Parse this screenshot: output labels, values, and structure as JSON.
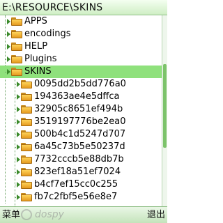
{
  "title": "E:\\RESOURCE\\SKINS",
  "tree": [
    {
      "label": "APPS",
      "expandable": true,
      "level": 0,
      "selected": false
    },
    {
      "label": "encodings",
      "expandable": true,
      "level": 0,
      "selected": false
    },
    {
      "label": "HELP",
      "expandable": true,
      "level": 0,
      "selected": false
    },
    {
      "label": "Plugins",
      "expandable": true,
      "level": 0,
      "selected": false
    },
    {
      "label": "SKINS",
      "expandable": true,
      "level": 0,
      "selected": true
    },
    {
      "label": "0095dd2b5dd776a0",
      "expandable": true,
      "level": 1,
      "selected": false
    },
    {
      "label": "194363ae4e5dffca",
      "expandable": true,
      "level": 1,
      "selected": false
    },
    {
      "label": "32905c8651ef494b",
      "expandable": true,
      "level": 1,
      "selected": false
    },
    {
      "label": "3519197776be2ea0",
      "expandable": true,
      "level": 1,
      "selected": false
    },
    {
      "label": "500b4c1d5247d707",
      "expandable": true,
      "level": 1,
      "selected": false
    },
    {
      "label": "6a45c73b5e50237d",
      "expandable": true,
      "level": 1,
      "selected": false
    },
    {
      "label": "7732cccb5e88db7b",
      "expandable": true,
      "level": 1,
      "selected": false
    },
    {
      "label": "823ef18a51ef7024",
      "expandable": true,
      "level": 1,
      "selected": false
    },
    {
      "label": "b4cf7ef15cc0c255",
      "expandable": true,
      "level": 1,
      "selected": false
    },
    {
      "label": "fb7c2fbf5e56e8e7",
      "expandable": true,
      "level": 1,
      "selected": false
    }
  ],
  "softkeys": {
    "left": "菜单",
    "right": "退出"
  },
  "watermark": "dospy",
  "colors": {
    "selection": "#8fe17c",
    "accent_green": "#3a8a2a",
    "folder": "#f2b43a"
  },
  "icons": {
    "expander": "triangle-right-icon",
    "folder": "folder-icon"
  }
}
